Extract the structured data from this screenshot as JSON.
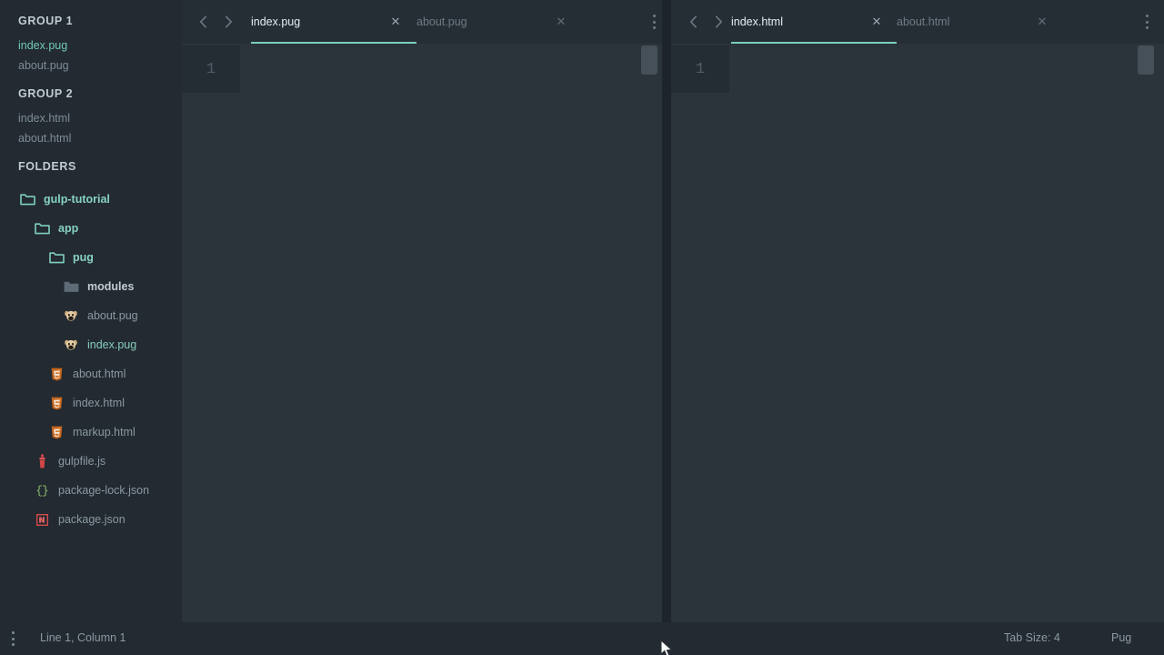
{
  "theme": {
    "bg": "#232a31",
    "editor_bg": "#2b333b",
    "tabbar_bg": "#262e35",
    "accent": "#79cfbb",
    "muted_text": "#7d8c99",
    "bright_text": "#e6edf3"
  },
  "sidebar": {
    "groups": [
      {
        "title": "GROUP 1",
        "items": [
          {
            "label": "index.pug",
            "state": "active"
          },
          {
            "label": "about.pug",
            "state": "normal"
          }
        ]
      },
      {
        "title": "GROUP 2",
        "items": [
          {
            "label": "index.html",
            "state": "normal"
          },
          {
            "label": "about.html",
            "state": "normal"
          }
        ]
      }
    ],
    "folders_title": "FOLDERS",
    "tree": [
      {
        "label": "gulp-tutorial",
        "kind": "folder-open",
        "icon": "folder-open-icon",
        "depth": 0,
        "state": "normal"
      },
      {
        "label": "app",
        "kind": "folder-open",
        "icon": "folder-open-icon",
        "depth": 1,
        "state": "normal"
      },
      {
        "label": "pug",
        "kind": "folder-open",
        "icon": "folder-open-icon",
        "depth": 2,
        "state": "normal"
      },
      {
        "label": "modules",
        "kind": "folder-closed",
        "icon": "folder-closed-icon",
        "depth": 3,
        "state": "muted"
      },
      {
        "label": "about.pug",
        "kind": "file",
        "icon": "pug-file-icon",
        "depth": 3,
        "state": "normal"
      },
      {
        "label": "index.pug",
        "kind": "file",
        "icon": "pug-file-icon",
        "depth": 3,
        "state": "active"
      },
      {
        "label": "about.html",
        "kind": "file",
        "icon": "html5-file-icon",
        "depth": 2,
        "state": "normal"
      },
      {
        "label": "index.html",
        "kind": "file",
        "icon": "html5-file-icon",
        "depth": 2,
        "state": "normal"
      },
      {
        "label": "markup.html",
        "kind": "file",
        "icon": "html5-file-icon",
        "depth": 2,
        "state": "normal"
      },
      {
        "label": "gulpfile.js",
        "kind": "file",
        "icon": "gulp-file-icon",
        "depth": 1,
        "state": "normal"
      },
      {
        "label": "package-lock.json",
        "kind": "file",
        "icon": "json-file-icon",
        "depth": 1,
        "state": "normal"
      },
      {
        "label": "package.json",
        "kind": "file",
        "icon": "npm-file-icon",
        "depth": 1,
        "state": "normal"
      }
    ]
  },
  "panes": [
    {
      "id": "left",
      "nav_back_icon": "chevron-left-icon",
      "nav_forward_icon": "chevron-right-icon",
      "menu_icon": "more-vertical-icon",
      "tabs": [
        {
          "label": "index.pug",
          "active": true,
          "close_icon": "close-icon"
        },
        {
          "label": "about.pug",
          "active": false,
          "close_icon": "close-icon"
        }
      ],
      "gutter_line": "1"
    },
    {
      "id": "right",
      "nav_back_icon": "chevron-left-icon",
      "nav_forward_icon": "chevron-right-icon",
      "menu_icon": "more-vertical-icon",
      "tabs": [
        {
          "label": "index.html",
          "active": true,
          "close_icon": "close-icon"
        },
        {
          "label": "about.html",
          "active": false,
          "close_icon": "close-icon"
        }
      ],
      "gutter_line": "1"
    }
  ],
  "statusbar": {
    "menu_icon": "more-vertical-icon",
    "cursor_position": "Line 1, Column 1",
    "tab_size": "Tab Size: 4",
    "syntax_mode": "Pug"
  }
}
